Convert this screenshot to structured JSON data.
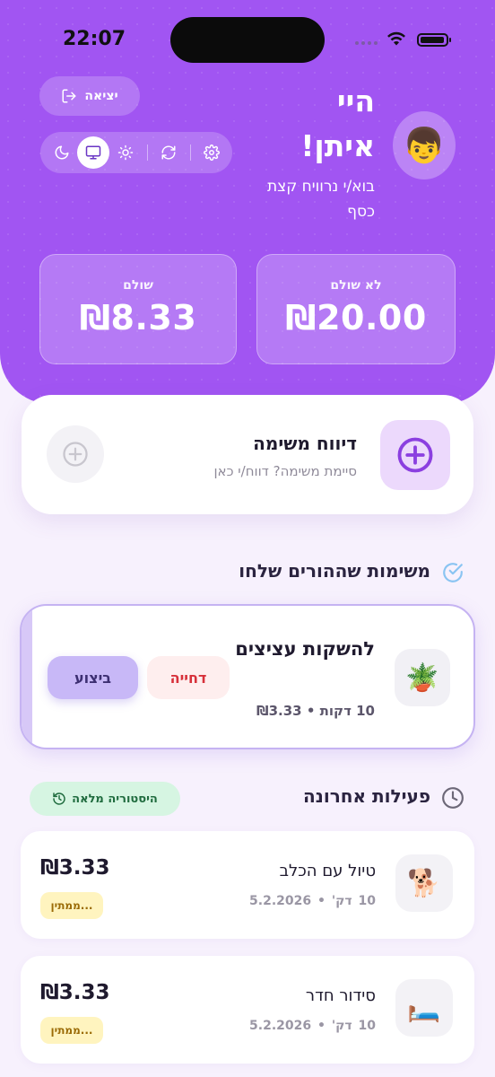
{
  "status_bar": {
    "time": "22:07"
  },
  "header": {
    "avatar_emoji": "👦",
    "greeting_line1": "היי",
    "greeting_line2": "איתן!",
    "subtitle": "בוא/י נרוויח קצת כסף",
    "logout_label": "יציאה",
    "toolbar_icons": [
      "moon-icon",
      "monitor-icon",
      "sun-icon",
      "refresh-icon",
      "gear-icon"
    ],
    "active_theme": "monitor-icon",
    "stats": [
      {
        "label": "לא שולם",
        "value": "₪20.00"
      },
      {
        "label": "שולם",
        "value": "₪8.33"
      }
    ]
  },
  "report": {
    "title": "דיווח משימה",
    "subtitle": "סיימת משימה? דווח/י כאן"
  },
  "tasks_section": {
    "title": "משימות שההורים שלחו",
    "task": {
      "emoji": "🪴",
      "title": "להשקות עציצים",
      "meta": "10 דקות • ₪3.33",
      "postpone_label": "דחייה",
      "do_label": "ביצוע"
    }
  },
  "activity_section": {
    "title": "פעילות אחרונה",
    "history_label": "היסטוריה מלאה",
    "items": [
      {
        "emoji": "🐕",
        "title": "טיול עם הכלב",
        "duration": "10 דק'",
        "date": "5.2.2026",
        "amount": "₪3.33",
        "status": "ממתין..."
      },
      {
        "emoji": "🛏️",
        "title": "סידור חדר",
        "duration": "10 דק'",
        "date": "5.2.2026",
        "amount": "₪3.33",
        "status": "ממתין..."
      }
    ]
  },
  "colors": {
    "header_purple": "#a155f2",
    "accent_purple": "#8b3fe0",
    "postpone_red": "#d7303a",
    "pending_yellow": "#fff4bf",
    "history_green": "#d6f5e2"
  }
}
